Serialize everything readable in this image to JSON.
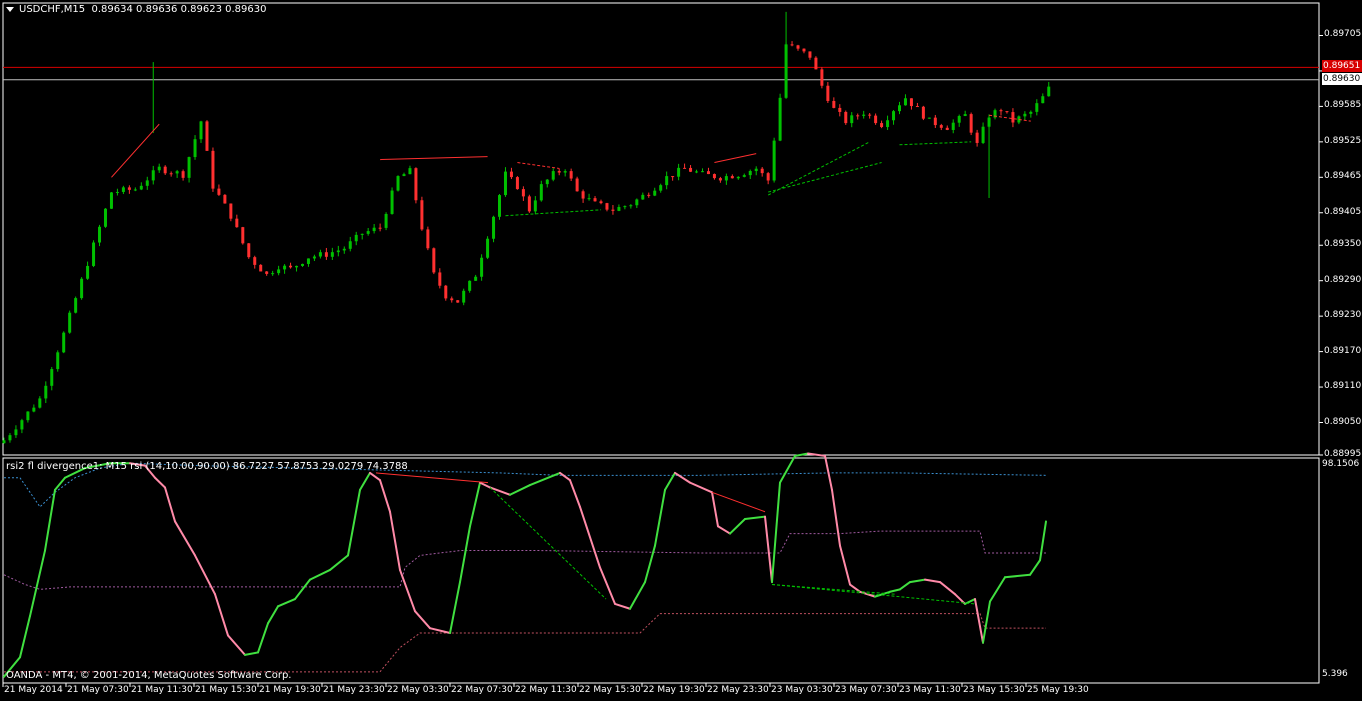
{
  "header": {
    "symbol": "USDCHF,M15",
    "ohlc": "0.89634 0.89636 0.89623 0.89630"
  },
  "indicator": {
    "caption": "rsi2 fl divergence1: M15 rsi (14,10.00,90.00) 86.7227 57.8753 29.0279 74.3788",
    "scale_top": "98.1506",
    "scale_bottom": "5.396"
  },
  "footer": {
    "text": "OANDA - MT4, © 2001-2014, MetaQuotes Software Corp."
  },
  "price_axis": {
    "labels": [
      "0.89705",
      "0.89645",
      "0.89585",
      "0.89525",
      "0.89465",
      "0.89405",
      "0.89350",
      "0.89290",
      "0.89230",
      "0.89170",
      "0.89110",
      "0.89050",
      "0.88995"
    ],
    "bid_tag": "0.89630",
    "line_tag": "0.89651"
  },
  "time_axis": {
    "labels": [
      "21 May 2014",
      "21 May 07:30",
      "21 May 11:30",
      "21 May 15:30",
      "21 May 19:30",
      "21 May 23:30",
      "22 May 03:30",
      "22 May 07:30",
      "22 May 11:30",
      "22 May 15:30",
      "22 May 19:30",
      "22 May 23:30",
      "23 May 03:30",
      "23 May 07:30",
      "23 May 11:30",
      "23 May 15:30",
      "25 May 19:30"
    ]
  },
  "colors": {
    "background": "#000000",
    "bull": "#00c000",
    "bear": "#ff3030",
    "bid_line": "#c0c0c0",
    "ref_line": "#d80000",
    "rsi_up": "#40e040",
    "rsi_down": "#ff8aa8",
    "band_upper": "#3a8fd0",
    "band_mid": "#a05aa0",
    "band_lower": "#c05060"
  },
  "chart_data": {
    "type": "candlestick",
    "symbol": "USDCHF",
    "timeframe": "M15",
    "ylim": [
      0.88995,
      0.8976
    ],
    "close_path": [
      [
        0,
        0.8902
      ],
      [
        6,
        0.8909
      ],
      [
        10,
        0.892
      ],
      [
        14,
        0.8932
      ],
      [
        18,
        0.8944
      ],
      [
        22,
        0.89445
      ],
      [
        26,
        0.8948
      ],
      [
        30,
        0.8947
      ],
      [
        33,
        0.8956
      ],
      [
        35,
        0.8945
      ],
      [
        38,
        0.894
      ],
      [
        41,
        0.8933
      ],
      [
        44,
        0.893
      ],
      [
        46,
        0.89315
      ],
      [
        48,
        0.8931
      ],
      [
        51,
        0.8933
      ],
      [
        54,
        0.89335
      ],
      [
        57,
        0.89345
      ],
      [
        60,
        0.8937
      ],
      [
        63,
        0.8938
      ],
      [
        66,
        0.89465
      ],
      [
        68,
        0.89475
      ],
      [
        70,
        0.8938
      ],
      [
        72,
        0.893
      ],
      [
        74,
        0.89265
      ],
      [
        76,
        0.89255
      ],
      [
        79,
        0.893
      ],
      [
        82,
        0.894
      ],
      [
        84,
        0.8947
      ],
      [
        86,
        0.8945
      ],
      [
        88,
        0.8941
      ],
      [
        90,
        0.8945
      ],
      [
        92,
        0.8947
      ],
      [
        94,
        0.8948
      ],
      [
        96,
        0.8944
      ],
      [
        99,
        0.8942
      ],
      [
        102,
        0.8941
      ],
      [
        105,
        0.8942
      ],
      [
        108,
        0.8944
      ],
      [
        111,
        0.89465
      ],
      [
        114,
        0.8948
      ],
      [
        117,
        0.8947
      ],
      [
        120,
        0.89465
      ],
      [
        123,
        0.8947
      ],
      [
        126,
        0.8948
      ],
      [
        128,
        0.8946
      ],
      [
        130,
        0.896
      ],
      [
        131,
        0.8969
      ],
      [
        133,
        0.8968
      ],
      [
        135,
        0.8967
      ],
      [
        137,
        0.8962
      ],
      [
        139,
        0.8958
      ],
      [
        141,
        0.8956
      ],
      [
        144,
        0.89575
      ],
      [
        147,
        0.89555
      ],
      [
        149,
        0.8958
      ],
      [
        151,
        0.896
      ],
      [
        153,
        0.8958
      ],
      [
        155,
        0.8956
      ],
      [
        158,
        0.8955
      ],
      [
        161,
        0.8957
      ],
      [
        163,
        0.8952
      ],
      [
        165,
        0.8957
      ],
      [
        167,
        0.8958
      ],
      [
        169,
        0.8956
      ],
      [
        172,
        0.89575
      ],
      [
        174,
        0.896
      ],
      [
        176,
        0.8963
      ]
    ],
    "rsi_levels": {
      "period": 14,
      "low": 10.0,
      "high": 90.0
    },
    "rsi_readings": [
      86.7227,
      57.8753,
      29.0279,
      74.3788
    ],
    "rsi_ylim": [
      5.396,
      98.1506
    ]
  }
}
